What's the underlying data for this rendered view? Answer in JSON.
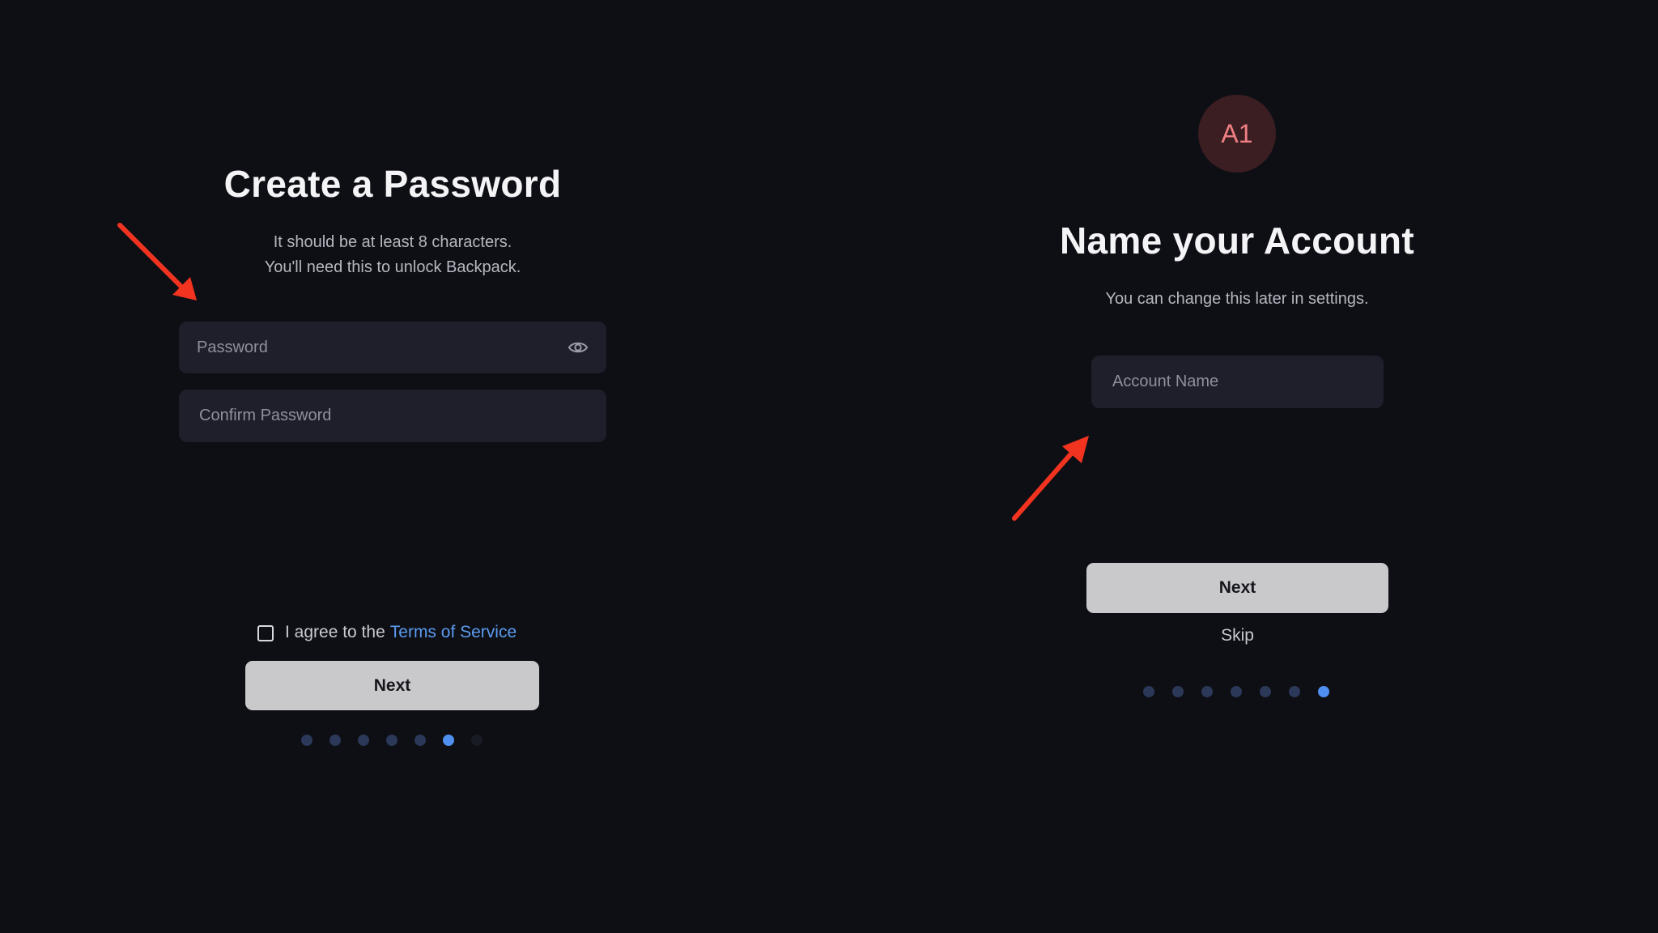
{
  "colors": {
    "background": "#0e0f14",
    "field_bg": "#1e1f2a",
    "button_bg": "#c9c9cc",
    "link": "#5a9bf0",
    "dot_active": "#4f8ff0",
    "dot_inactive": "#2b3857",
    "avatar_bg": "#3a1e22",
    "avatar_text": "#f07f83",
    "annotation_arrow": "#f2331f"
  },
  "password_screen": {
    "title": "Create a Password",
    "subtitle_line1": "It should be at least 8 characters.",
    "subtitle_line2": "You'll need this to unlock Backpack.",
    "password_placeholder": "Password",
    "confirm_placeholder": "Confirm Password",
    "show_password_icon": "eye-icon",
    "agree_text": "I agree to the",
    "terms_link": "Terms of Service",
    "checkbox_checked": false,
    "next_label": "Next",
    "progress": {
      "total_steps": 7,
      "current_step": 6
    }
  },
  "account_screen": {
    "avatar_text": "A1",
    "title": "Name your Account",
    "subtitle": "You can change this later in settings.",
    "account_name_placeholder": "Account Name",
    "next_label": "Next",
    "skip_label": "Skip",
    "progress": {
      "total_steps": 7,
      "current_step": 7
    }
  }
}
